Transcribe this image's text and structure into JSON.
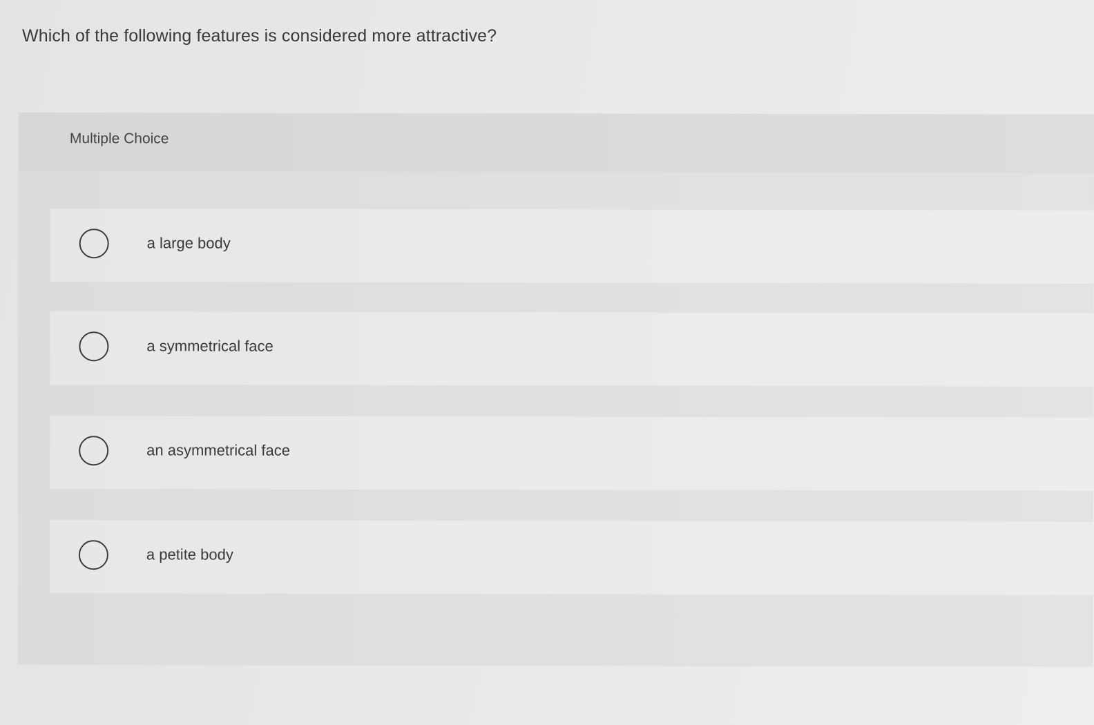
{
  "question": {
    "text": "Which of the following features is considered more attractive?"
  },
  "multiple_choice": {
    "label": "Multiple Choice",
    "options": [
      {
        "text": "a large body",
        "selected": false
      },
      {
        "text": "a symmetrical face",
        "selected": false
      },
      {
        "text": "an asymmetrical face",
        "selected": false
      },
      {
        "text": "a petite body",
        "selected": false
      }
    ]
  }
}
